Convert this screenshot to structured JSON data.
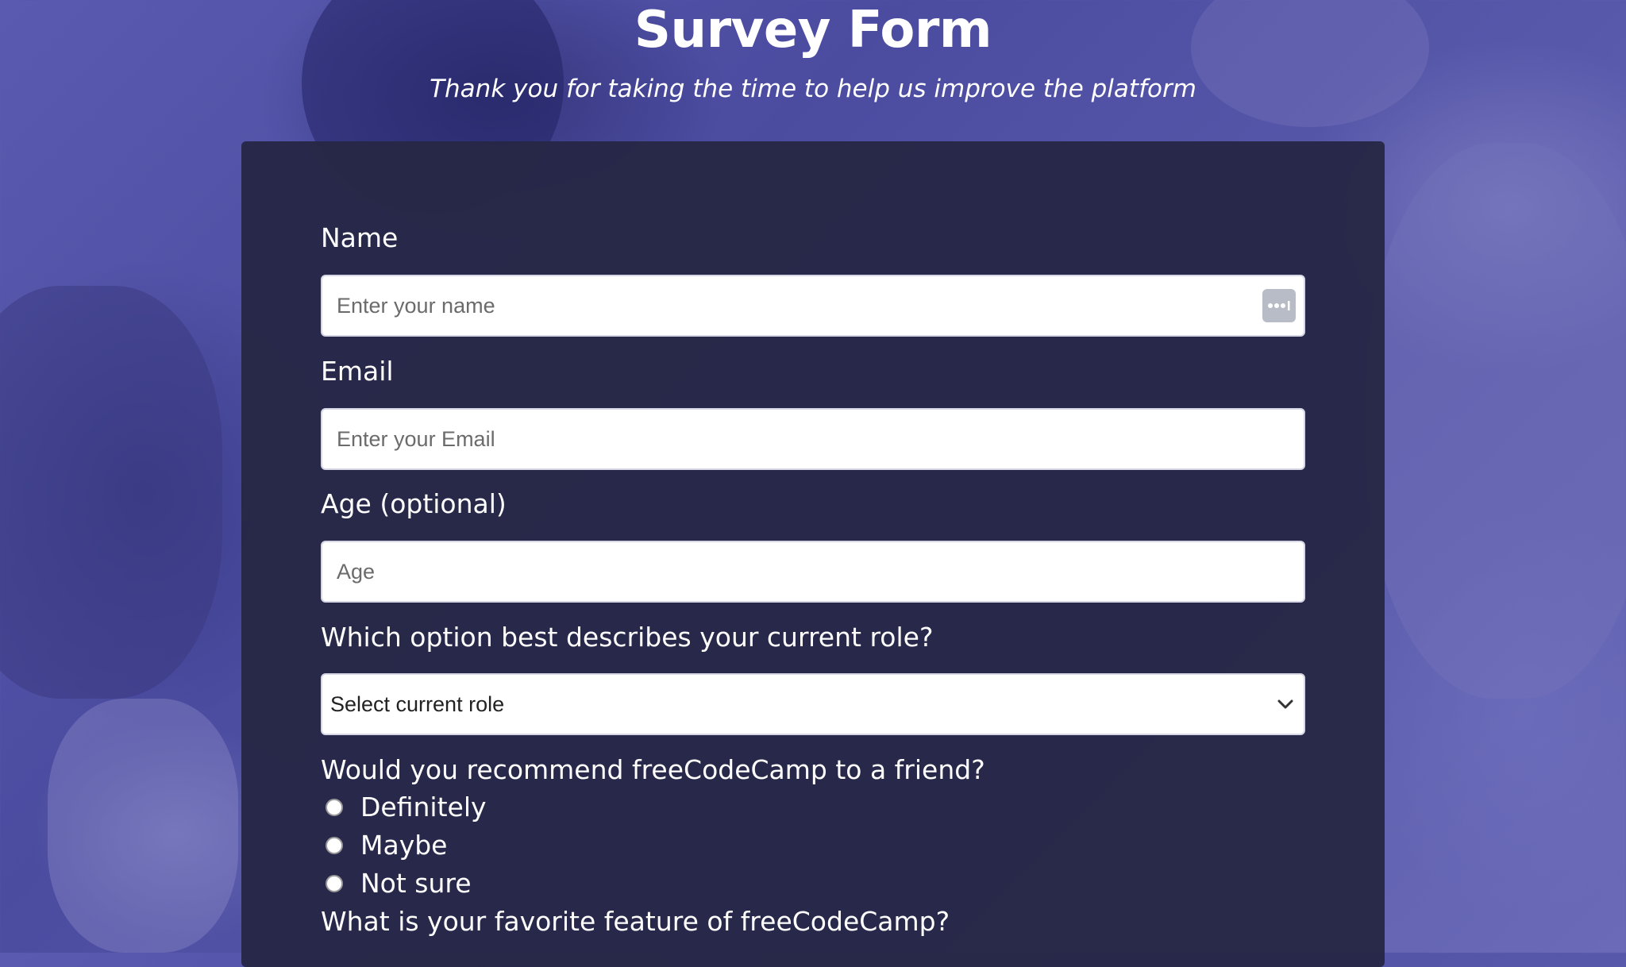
{
  "header": {
    "title": "Survey Form",
    "subtitle": "Thank you for taking the time to help us improve the platform"
  },
  "form": {
    "name": {
      "label": "Name",
      "placeholder": "Enter your name",
      "value": ""
    },
    "email": {
      "label": "Email",
      "placeholder": "Enter your Email",
      "value": ""
    },
    "age": {
      "label": "Age (optional)",
      "placeholder": "Age",
      "value": ""
    },
    "role": {
      "label": "Which option best describes your current role?",
      "selected": "Select current role"
    },
    "recommend": {
      "label": "Would you recommend freeCodeCamp to a friend?",
      "options": [
        "Definitely",
        "Maybe",
        "Not sure"
      ]
    },
    "favorite_feature": {
      "label": "What is your favorite feature of freeCodeCamp?"
    }
  },
  "icons": {
    "autofill": "password-autofill-icon",
    "dropdown": "chevron-down-icon"
  },
  "colors": {
    "background": "#5a5bb0",
    "card": "#262646",
    "text": "#ffffff",
    "input_bg": "#ffffff"
  }
}
